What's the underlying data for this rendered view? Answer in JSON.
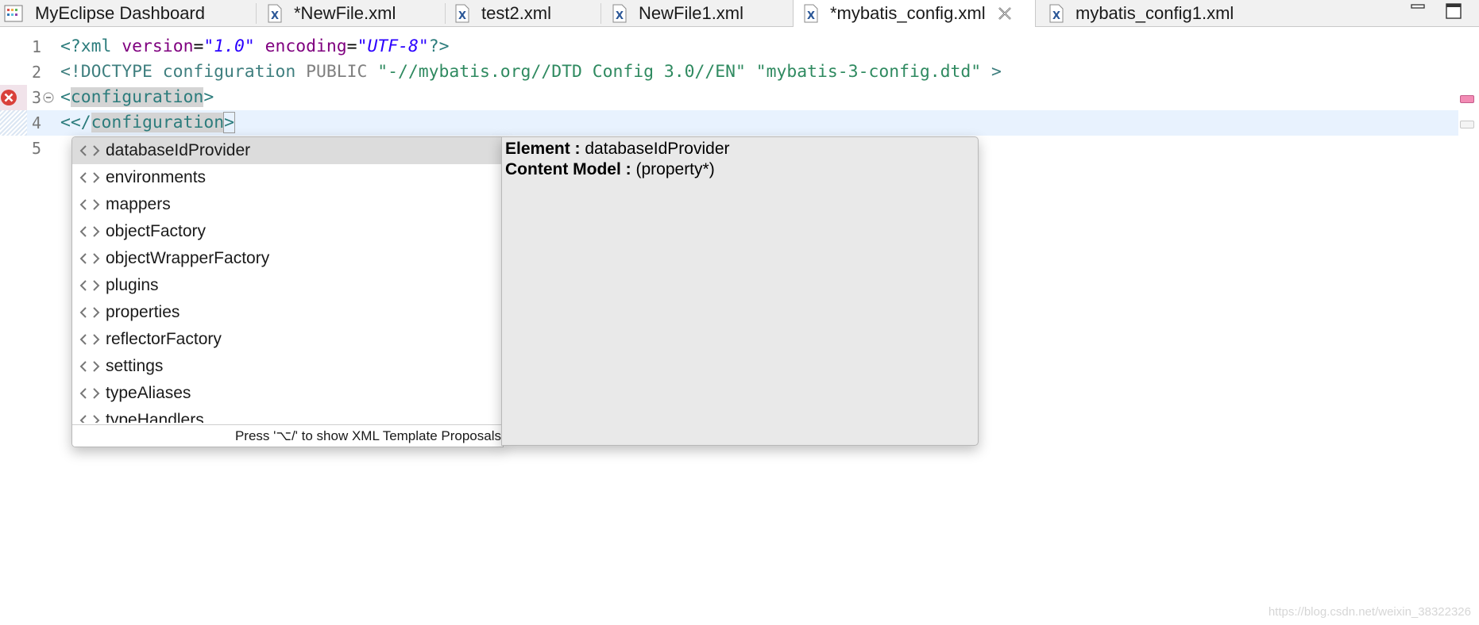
{
  "tabs": [
    {
      "label": "MyEclipse Dashboard",
      "icon": "dashboard-icon",
      "active": false
    },
    {
      "label": "*NewFile.xml",
      "icon": "xml-file-icon",
      "active": false
    },
    {
      "label": "test2.xml",
      "icon": "xml-file-icon",
      "active": false
    },
    {
      "label": "NewFile1.xml",
      "icon": "xml-file-icon",
      "active": false
    },
    {
      "label": "*mybatis_config.xml",
      "icon": "xml-file-icon",
      "active": true
    },
    {
      "label": "mybatis_config1.xml",
      "icon": "xml-file-icon",
      "active": false
    }
  ],
  "window_controls": {
    "minimize_icon": "minimize-icon",
    "maximize_icon": "maximize-icon"
  },
  "editor": {
    "line_numbers": [
      "1",
      "2",
      "3",
      "4",
      "5"
    ],
    "line1": {
      "open": "<?",
      "name": "xml",
      "attr1": "version",
      "eq": "=",
      "val1": "\"1.0\"",
      "attr2": "encoding",
      "val2": "\"UTF-8\"",
      "close": "?>"
    },
    "line2": {
      "open": "<!DOCTYPE configuration",
      "public": "PUBLIC",
      "pubid": "\"-//mybatis.org//DTD Config 3.0//EN\"",
      "sysid": "\"mybatis-3-config.dtd\"",
      "close": ">"
    },
    "line3": {
      "lt": "<",
      "name": "configuration",
      "gt": ">"
    },
    "line4": {
      "typed": "<",
      "lt": "</",
      "name": "configuration",
      "gt": ">"
    },
    "error_icon": "error-icon",
    "fold_icon": "collapse-icon"
  },
  "content_assist": {
    "proposals": [
      "databaseIdProvider",
      "environments",
      "mappers",
      "objectFactory",
      "objectWrapperFactory",
      "plugins",
      "properties",
      "reflectorFactory",
      "settings",
      "typeAliases",
      "typeHandlers"
    ],
    "selected_index": 0,
    "proposal_icon": "xml-element-icon",
    "status": "Press '⌥/' to show XML Template Proposals",
    "info": {
      "element_label": "Element :",
      "element_value": "databaseIdProvider",
      "content_model_label": "Content Model :",
      "content_model_value": "(property*)"
    }
  },
  "watermark": "https://blog.csdn.net/weixin_38322326",
  "colors": {
    "tag": "#2c7c7c",
    "attr": "#7f007f",
    "string": "#2a00ff",
    "current_line": "#e8f2fe",
    "error_marker": "#f28bb4"
  }
}
